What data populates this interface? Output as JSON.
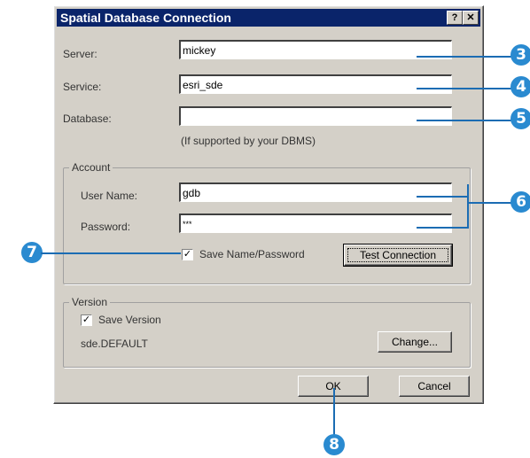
{
  "window": {
    "title": "Spatial Database Connection",
    "help_label": "?",
    "close_label": "✕"
  },
  "connection": {
    "server_label": "Server:",
    "server_value": "mickey",
    "service_label": "Service:",
    "service_value": "esri_sde",
    "database_label": "Database:",
    "database_value": "",
    "database_hint": "(If supported by your DBMS)"
  },
  "account": {
    "legend": "Account",
    "username_label": "User Name:",
    "username_value": "gdb",
    "password_label": "Password:",
    "password_value": "***",
    "save_label": "Save Name/Password",
    "save_checked": true,
    "test_button": "Test Connection"
  },
  "version": {
    "legend": "Version",
    "save_label": "Save Version",
    "save_checked": true,
    "current_value": "sde.DEFAULT",
    "change_button": "Change..."
  },
  "buttons": {
    "ok": "OK",
    "cancel": "Cancel"
  },
  "callouts": {
    "c3": "3",
    "c4": "4",
    "c5": "5",
    "c6": "6",
    "c7": "7",
    "c8": "8"
  },
  "colors": {
    "titlebar": "#0a246a",
    "dialog_face": "#d4d0c8",
    "callout": "#2a8ad0"
  }
}
